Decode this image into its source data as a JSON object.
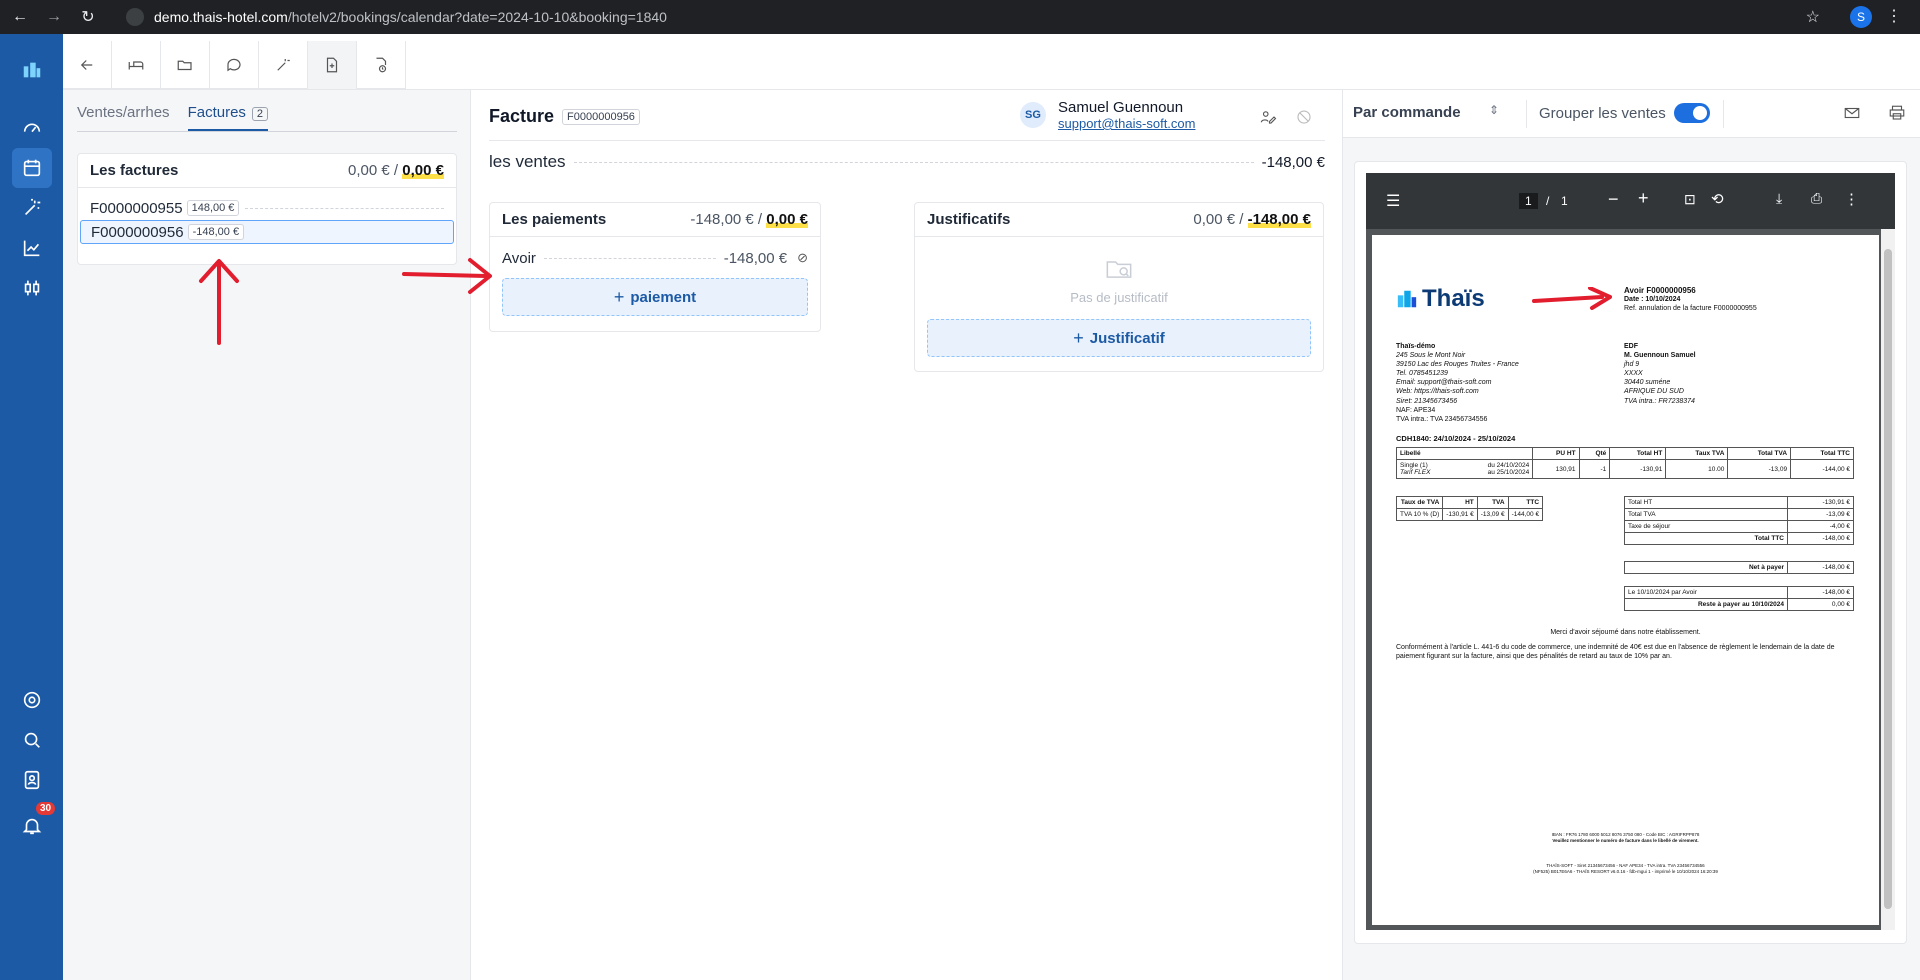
{
  "browser": {
    "url_host": "demo.thais-hotel.com",
    "url_path": "/hotelv2/bookings/calendar?date=2024-10-10&booking=1840",
    "profile_initial": "S"
  },
  "rail": {
    "notifications_count": "30"
  },
  "left": {
    "tabs": [
      {
        "label": "Ventes/arrhes"
      },
      {
        "label": "Factures",
        "count": "2"
      }
    ],
    "invoices_card": {
      "title": "Les factures",
      "amount_paid": "0,00 €",
      "amount_sep": " / ",
      "amount_due": "0,00 €",
      "rows": [
        {
          "number": "F0000000955",
          "amount": "148,00 €"
        },
        {
          "number": "F0000000956",
          "amount": "-148,00 €"
        }
      ]
    }
  },
  "center": {
    "title": "Facture",
    "invoice_number": "F0000000956",
    "user": {
      "initials": "SG",
      "name": "Samuel Guennoun",
      "email": "support@thais-soft.com"
    },
    "ventes": {
      "label": "les ventes",
      "amount": "-148,00 €"
    },
    "payments": {
      "title": "Les paiements",
      "amount": "-148,00 €",
      "sep": " / ",
      "due": "0,00 €",
      "row_label": "Avoir",
      "row_amount": "-148,00 €",
      "add_label": "paiement"
    },
    "justifs": {
      "title": "Justificatifs",
      "amount": "0,00 €",
      "sep": " / ",
      "due": "-148,00 €",
      "empty_label": "Pas de justificatif",
      "add_label": "Justificatif"
    }
  },
  "right": {
    "select_value": "Par commande",
    "group_label": "Grouper les ventes",
    "group_enabled": true,
    "pdf": {
      "page_current": "1",
      "page_sep": "/",
      "page_total": "1",
      "brand": "Thaïs",
      "doc_title": "Avoir F0000000956",
      "doc_date": "Date : 10/10/2024",
      "doc_ref": "Ref. annulation de la facture F0000000955",
      "seller": [
        "Thaïs-démo",
        "245 Sous le Mont Noir",
        "39150 Lac des Rouges Truites - France",
        "Tel. 0785451239",
        "Email: support@thais-soft.com",
        "Web: https://thais-soft.com",
        "Siret: 21345673456",
        "NAF: APE34",
        "TVA intra.: TVA 23456734556"
      ],
      "buyer": [
        "EDF",
        "M. Guennoun Samuel",
        "jhd 9",
        "XXXX",
        "30440 suméne",
        "AFRIQUE DU SUD",
        "TVA intra.: FR7238374"
      ],
      "stay": "CDH1840: 24/10/2024 - 25/10/2024",
      "lines_head": [
        "Libellé",
        "PU HT",
        "Qté",
        "Total HT",
        "Taux TVA",
        "Total TVA",
        "Total TTC"
      ],
      "line": {
        "label": "Single (1)",
        "tarif": "Tarif FLEX",
        "from": "du 24/10/2024",
        "to": "au 25/10/2024",
        "values": [
          "130,91",
          "-1",
          "-130,91",
          "10.00",
          "-13,09",
          "-144,00 €"
        ]
      },
      "tva_head": [
        "Taux de TVA",
        "HT",
        "TVA",
        "TTC"
      ],
      "tva_row": [
        "TVA 10 % (D)",
        "-130,91 €",
        "-13,09 €",
        "-144,00 €"
      ],
      "totals": [
        [
          "Total HT",
          "-130,91 €"
        ],
        [
          "Total TVA",
          "-13,09 €"
        ],
        [
          "Taxe de séjour",
          "-4,00 €"
        ],
        [
          "Total TTC",
          "-148,00 €"
        ]
      ],
      "net": [
        "Net à payer",
        "-148,00 €"
      ],
      "paid": [
        [
          "Le 10/10/2024 par Avoir",
          "-148,00 €"
        ],
        [
          "Reste à payer au 10/10/2024",
          "0,00 €"
        ]
      ],
      "thanks": "Merci d'avoir séjourné dans notre établissement.",
      "legal": "Conformément à l'article L. 441-6 du code de commerce, une indemnité de 40€ est due en l'absence de règlement le lendemain de la date de paiement figurant sur la facture, ainsi que des pénalités de retard au taux de 10% par an.",
      "footer1": "IBAN : FR76 1780 6000 5012 8076 3750 080 - Code BIC : AGRIFRPP878",
      "footer2": "Veuillez mentionner le numéro de facture dans le libellé de virement.",
      "footer3": "THAÏS-SOFT - Siret 21345673456 - NAF APE34 - TVA intra. TVA 23456734556",
      "footer4": "(NF525) B017E6A6 - THAÏS RESORT v6.0.16 - fdb-mgui 1 - imprimé le 10/10/2024 16:20:39"
    }
  },
  "colors": {
    "accent": "#1d5aa5",
    "highlight": "#fde047",
    "arrow": "#e11d2e"
  }
}
